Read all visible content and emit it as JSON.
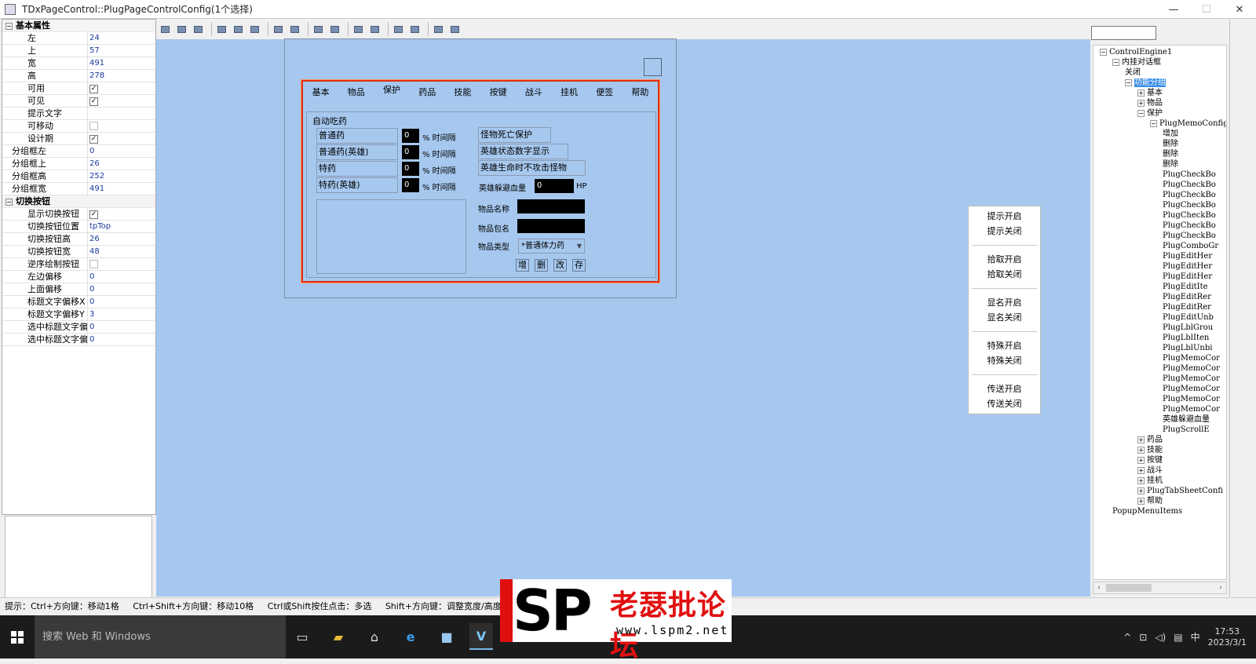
{
  "window": {
    "title": "TDxPageControl::PlugPageControlConfig(1个选择)",
    "minimize": "—",
    "maximize": "☐",
    "close": "✕"
  },
  "properties": {
    "categories": [
      {
        "name": "基本属性",
        "rows": [
          {
            "name": "左",
            "value": "24"
          },
          {
            "name": "上",
            "value": "57"
          },
          {
            "name": "宽",
            "value": "491"
          },
          {
            "name": "高",
            "value": "278"
          },
          {
            "name": "可用",
            "check": true
          },
          {
            "name": "可见",
            "check": true
          },
          {
            "name": "提示文字",
            "value": ""
          },
          {
            "name": "可移动",
            "check": false
          },
          {
            "name": "设计期",
            "check": true
          },
          {
            "name": "分组框左",
            "value": "0",
            "sub": true
          },
          {
            "name": "分组框上",
            "value": "26",
            "sub": true
          },
          {
            "name": "分组框高",
            "value": "252",
            "sub": true
          },
          {
            "name": "分组框宽",
            "value": "491",
            "sub": true
          }
        ]
      },
      {
        "name": "切换按钮",
        "rows": [
          {
            "name": "显示切换按钮",
            "check": true
          },
          {
            "name": "切换按钮位置",
            "value": "tpTop"
          },
          {
            "name": "切换按钮高",
            "value": "26"
          },
          {
            "name": "切换按钮宽",
            "value": "48"
          },
          {
            "name": "逆序绘制按钮",
            "check": false
          },
          {
            "name": "左边偏移",
            "value": "0"
          },
          {
            "name": "上面偏移",
            "value": "0"
          },
          {
            "name": "标题文字偏移X",
            "value": "0"
          },
          {
            "name": "标题文字偏移Y",
            "value": "3"
          },
          {
            "name": "选中标题文字偏",
            "value": "0"
          },
          {
            "name": "选中标题文字偏",
            "value": "0"
          }
        ]
      }
    ]
  },
  "form": {
    "tabs": [
      "基本",
      "物品",
      "保护",
      "药品",
      "技能",
      "按键",
      "战斗",
      "挂机",
      "便签",
      "帮助"
    ],
    "selected_tab": "保护",
    "group_label": "自动吃药",
    "drug_rows": [
      {
        "label": "普通药",
        "value": "0",
        "unit": "% 时间隔"
      },
      {
        "label": "普通药(英雄)",
        "value": "0",
        "unit": "% 时间隔"
      },
      {
        "label": "特药",
        "value": "0",
        "unit": "% 时间隔"
      },
      {
        "label": "特药(英雄)",
        "value": "0",
        "unit": "% 时间隔"
      }
    ],
    "checks": [
      "怪物死亡保护",
      "英雄状态数字显示",
      "英雄生命时不攻击怪物"
    ],
    "hero_hp_label": "英雄躲避血量",
    "hero_hp_value": "0",
    "hero_hp_unit": "HP",
    "item_name_label": "物品名称",
    "item_pack_label": "物品包名",
    "item_type_label": "物品类型",
    "item_type_value": "*普通体力药",
    "buttons": [
      "增",
      "删",
      "改",
      "存"
    ]
  },
  "popup_menu": [
    [
      "提示开启",
      "提示关闭"
    ],
    [
      "拾取开启",
      "拾取关闭"
    ],
    [
      "显名开启",
      "显名关闭"
    ],
    [
      "特殊开启",
      "特殊关闭"
    ],
    [
      "传送开启",
      "传送关闭"
    ]
  ],
  "tree": [
    {
      "label": "ControlEngine1",
      "depth": 0,
      "exp": "−"
    },
    {
      "label": "内挂对话框",
      "depth": 1,
      "exp": "−"
    },
    {
      "label": "关闭",
      "depth": 2
    },
    {
      "label": "功能分组",
      "depth": 2,
      "exp": "−",
      "selected": true
    },
    {
      "label": "基本",
      "depth": 3,
      "exp": "+"
    },
    {
      "label": "物品",
      "depth": 3,
      "exp": "+"
    },
    {
      "label": "保护",
      "depth": 3,
      "exp": "−"
    },
    {
      "label": "PlugMemoConfig",
      "depth": 4,
      "exp": "−"
    },
    {
      "label": "增加",
      "depth": 5
    },
    {
      "label": "删除",
      "depth": 5
    },
    {
      "label": "删除",
      "depth": 5
    },
    {
      "label": "删除",
      "depth": 5
    },
    {
      "label": "PlugCheckBo",
      "depth": 5
    },
    {
      "label": "PlugCheckBo",
      "depth": 5
    },
    {
      "label": "PlugCheckBo",
      "depth": 5
    },
    {
      "label": "PlugCheckBo",
      "depth": 5
    },
    {
      "label": "PlugCheckBo",
      "depth": 5
    },
    {
      "label": "PlugCheckBo",
      "depth": 5
    },
    {
      "label": "PlugCheckBo",
      "depth": 5
    },
    {
      "label": "PlugComboGr",
      "depth": 5
    },
    {
      "label": "PlugEditHer",
      "depth": 5
    },
    {
      "label": "PlugEditHer",
      "depth": 5
    },
    {
      "label": "PlugEditHer",
      "depth": 5
    },
    {
      "label": "PlugEditIte",
      "depth": 5
    },
    {
      "label": "PlugEditRer",
      "depth": 5
    },
    {
      "label": "PlugEditRer",
      "depth": 5
    },
    {
      "label": "PlugEditUnb",
      "depth": 5
    },
    {
      "label": "PlugLblGrou",
      "depth": 5
    },
    {
      "label": "PlugLblIten",
      "depth": 5
    },
    {
      "label": "PlugLblUnbi",
      "depth": 5
    },
    {
      "label": "PlugMemoCor",
      "depth": 5
    },
    {
      "label": "PlugMemoCor",
      "depth": 5
    },
    {
      "label": "PlugMemoCor",
      "depth": 5
    },
    {
      "label": "PlugMemoCor",
      "depth": 5
    },
    {
      "label": "PlugMemoCor",
      "depth": 5
    },
    {
      "label": "PlugMemoCor",
      "depth": 5
    },
    {
      "label": "英雄躲避血量",
      "depth": 5
    },
    {
      "label": "PlugScrollE",
      "depth": 5
    },
    {
      "label": "药品",
      "depth": 3,
      "exp": "+"
    },
    {
      "label": "技能",
      "depth": 3,
      "exp": "+"
    },
    {
      "label": "按键",
      "depth": 3,
      "exp": "+"
    },
    {
      "label": "战斗",
      "depth": 3,
      "exp": "+"
    },
    {
      "label": "挂机",
      "depth": 3,
      "exp": "+"
    },
    {
      "label": "PlugTabSheetConfi",
      "depth": 3,
      "exp": "+"
    },
    {
      "label": "帮助",
      "depth": 3,
      "exp": "+"
    },
    {
      "label": "PopupMenuItems",
      "depth": 1
    }
  ],
  "status": {
    "text": "提示：Ctrl+方向键：移动1格     Ctrl+Shift+方向键：移动10格     Ctrl或Shift按住点击：多选     Shift+方向键：调整宽度/高度"
  },
  "taskbar": {
    "search_placeholder": "搜索 Web 和 Windows",
    "ime": "中",
    "time": "17:53",
    "date": "2023/3/1"
  },
  "watermark": {
    "brand": "SP",
    "cn": "老瑟批论坛",
    "url": "www.lspm2.net"
  }
}
